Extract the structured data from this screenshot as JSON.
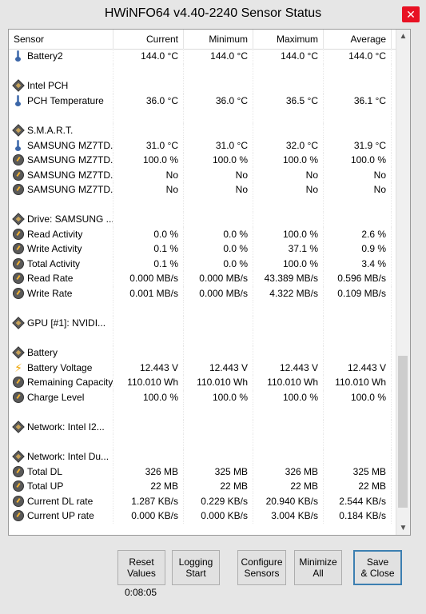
{
  "window": {
    "title": "HWiNFO64 v4.40-2240 Sensor Status",
    "close_glyph": "✕"
  },
  "columns": [
    "Sensor",
    "Current",
    "Minimum",
    "Maximum",
    "Average"
  ],
  "rows": [
    {
      "icon": "thermometer-icon",
      "name": "Battery2",
      "cur": "144.0 °C",
      "min": "144.0 °C",
      "max": "144.0 °C",
      "avg": "144.0 °C"
    },
    {
      "icon": "",
      "name": "",
      "cur": "",
      "min": "",
      "max": "",
      "avg": ""
    },
    {
      "icon": "chip-icon",
      "name": "Intel PCH",
      "cur": "",
      "min": "",
      "max": "",
      "avg": ""
    },
    {
      "icon": "thermometer-icon",
      "name": "PCH Temperature",
      "cur": "36.0 °C",
      "min": "36.0 °C",
      "max": "36.5 °C",
      "avg": "36.1 °C"
    },
    {
      "icon": "",
      "name": "",
      "cur": "",
      "min": "",
      "max": "",
      "avg": ""
    },
    {
      "icon": "chip-icon",
      "name": "S.M.A.R.T.",
      "cur": "",
      "min": "",
      "max": "",
      "avg": ""
    },
    {
      "icon": "thermometer-icon",
      "name": "SAMSUNG MZ7TD...",
      "cur": "31.0 °C",
      "min": "31.0 °C",
      "max": "32.0 °C",
      "avg": "31.9 °C"
    },
    {
      "icon": "gauge-icon",
      "name": "SAMSUNG MZ7TD...",
      "cur": "100.0 %",
      "min": "100.0 %",
      "max": "100.0 %",
      "avg": "100.0 %"
    },
    {
      "icon": "gauge-icon",
      "name": "SAMSUNG MZ7TD...",
      "cur": "No",
      "min": "No",
      "max": "No",
      "avg": "No"
    },
    {
      "icon": "gauge-icon",
      "name": "SAMSUNG MZ7TD...",
      "cur": "No",
      "min": "No",
      "max": "No",
      "avg": "No"
    },
    {
      "icon": "",
      "name": "",
      "cur": "",
      "min": "",
      "max": "",
      "avg": ""
    },
    {
      "icon": "chip-icon",
      "name": "Drive: SAMSUNG ...",
      "cur": "",
      "min": "",
      "max": "",
      "avg": ""
    },
    {
      "icon": "gauge-icon",
      "name": "Read Activity",
      "cur": "0.0 %",
      "min": "0.0 %",
      "max": "100.0 %",
      "avg": "2.6 %"
    },
    {
      "icon": "gauge-icon",
      "name": "Write Activity",
      "cur": "0.1 %",
      "min": "0.0 %",
      "max": "37.1 %",
      "avg": "0.9 %"
    },
    {
      "icon": "gauge-icon",
      "name": "Total Activity",
      "cur": "0.1 %",
      "min": "0.0 %",
      "max": "100.0 %",
      "avg": "3.4 %"
    },
    {
      "icon": "gauge-icon",
      "name": "Read Rate",
      "cur": "0.000 MB/s",
      "min": "0.000 MB/s",
      "max": "43.389 MB/s",
      "avg": "0.596 MB/s"
    },
    {
      "icon": "gauge-icon",
      "name": "Write Rate",
      "cur": "0.001 MB/s",
      "min": "0.000 MB/s",
      "max": "4.322 MB/s",
      "avg": "0.109 MB/s"
    },
    {
      "icon": "",
      "name": "",
      "cur": "",
      "min": "",
      "max": "",
      "avg": ""
    },
    {
      "icon": "chip-icon",
      "name": "GPU [#1]: NVIDI...",
      "cur": "",
      "min": "",
      "max": "",
      "avg": ""
    },
    {
      "icon": "",
      "name": "",
      "cur": "",
      "min": "",
      "max": "",
      "avg": ""
    },
    {
      "icon": "chip-icon",
      "name": "Battery",
      "cur": "",
      "min": "",
      "max": "",
      "avg": ""
    },
    {
      "icon": "bolt-icon",
      "name": "Battery Voltage",
      "cur": "12.443 V",
      "min": "12.443 V",
      "max": "12.443 V",
      "avg": "12.443 V"
    },
    {
      "icon": "gauge-icon",
      "name": "Remaining Capacity",
      "cur": "110.010 Wh",
      "min": "110.010 Wh",
      "max": "110.010 Wh",
      "avg": "110.010 Wh"
    },
    {
      "icon": "gauge-icon",
      "name": "Charge Level",
      "cur": "100.0 %",
      "min": "100.0 %",
      "max": "100.0 %",
      "avg": "100.0 %"
    },
    {
      "icon": "",
      "name": "",
      "cur": "",
      "min": "",
      "max": "",
      "avg": ""
    },
    {
      "icon": "chip-icon",
      "name": "Network: Intel I2...",
      "cur": "",
      "min": "",
      "max": "",
      "avg": ""
    },
    {
      "icon": "",
      "name": "",
      "cur": "",
      "min": "",
      "max": "",
      "avg": ""
    },
    {
      "icon": "chip-icon",
      "name": "Network: Intel Du...",
      "cur": "",
      "min": "",
      "max": "",
      "avg": ""
    },
    {
      "icon": "gauge-icon",
      "name": "Total DL",
      "cur": "326 MB",
      "min": "325 MB",
      "max": "326 MB",
      "avg": "325 MB"
    },
    {
      "icon": "gauge-icon",
      "name": "Total UP",
      "cur": "22 MB",
      "min": "22 MB",
      "max": "22 MB",
      "avg": "22 MB"
    },
    {
      "icon": "gauge-icon",
      "name": "Current DL rate",
      "cur": "1.287 KB/s",
      "min": "0.229 KB/s",
      "max": "20.940 KB/s",
      "avg": "2.544 KB/s"
    },
    {
      "icon": "gauge-icon",
      "name": "Current UP rate",
      "cur": "0.000 KB/s",
      "min": "0.000 KB/s",
      "max": "3.004 KB/s",
      "avg": "0.184 KB/s"
    }
  ],
  "scrollbar": {
    "up_glyph": "▲",
    "down_glyph": "▼"
  },
  "buttons": {
    "reset": [
      "Reset",
      "Values"
    ],
    "logging": [
      "Logging",
      "Start"
    ],
    "configure": [
      "Configure",
      "Sensors"
    ],
    "minimize": [
      "Minimize",
      "All"
    ],
    "save": [
      "Save",
      "& Close"
    ]
  },
  "timer": "0:08:05"
}
